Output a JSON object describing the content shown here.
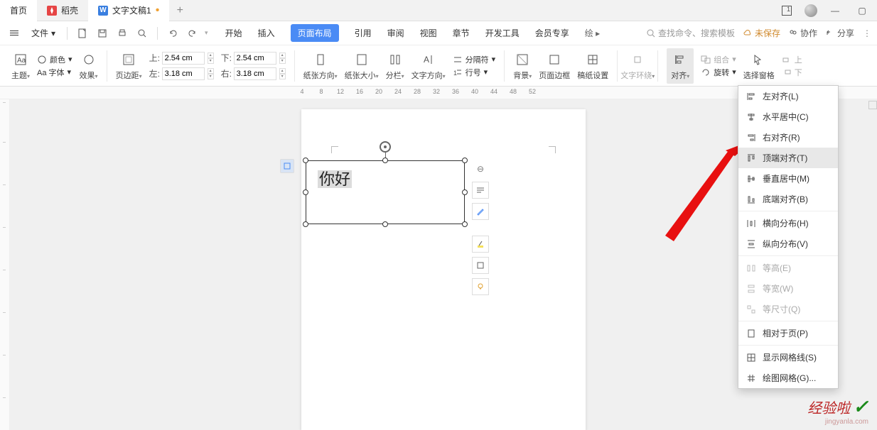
{
  "titlebar": {
    "home": "首页",
    "shell_name": "稻壳",
    "doc_name": "文字文稿1",
    "newtab": "+"
  },
  "menu": {
    "file": "文件",
    "ribbon_tabs": [
      "开始",
      "插入",
      "页面布局",
      "引用",
      "审阅",
      "视图",
      "章节",
      "开发工具",
      "会员专享"
    ],
    "drawing": "绘",
    "search_placeholder": "查找命令、搜索模板",
    "unsaved": "未保存",
    "coop": "协作",
    "share": "分享"
  },
  "ribbon": {
    "theme": "主题",
    "color": "颜色",
    "font": "Aa 字体",
    "effect": "效果",
    "margin": "页边距",
    "top": "上:",
    "bot": "下:",
    "left_m": "左:",
    "right_m": "右:",
    "m_vert": "2.54 cm",
    "m_horz": "3.18 cm",
    "orient": "纸张方向",
    "size": "纸张大小",
    "columns": "分栏",
    "textdir": "文字方向",
    "break": "分隔符",
    "lineno": "行号",
    "bg": "背景",
    "border": "页面边框",
    "grid": "稿纸设置",
    "wrap": "文字环绕",
    "align": "对齐",
    "group": "组合",
    "rotate": "旋转",
    "selpane": "选择窗格",
    "moveup": "上",
    "movedown": "下"
  },
  "ruler": [
    "4",
    "8",
    "12",
    "16",
    "20",
    "24",
    "28",
    "32",
    "36",
    "40",
    "44",
    "48",
    "52"
  ],
  "textbox_text": "你好",
  "align_menu": {
    "items": [
      {
        "icon": "al",
        "label": "左对齐(L)"
      },
      {
        "icon": "ac",
        "label": "水平居中(C)"
      },
      {
        "icon": "ar",
        "label": "右对齐(R)"
      },
      {
        "icon": "at",
        "label": "顶端对齐(T)",
        "hl": true
      },
      {
        "icon": "am",
        "label": "垂直居中(M)"
      },
      {
        "icon": "ab",
        "label": "底端对齐(B)"
      }
    ],
    "dist": [
      {
        "icon": "dh",
        "label": "横向分布(H)"
      },
      {
        "icon": "dv",
        "label": "纵向分布(V)"
      }
    ],
    "equal": [
      {
        "icon": "eh",
        "label": "等高(E)"
      },
      {
        "icon": "ew",
        "label": "等宽(W)"
      },
      {
        "icon": "es",
        "label": "等尺寸(Q)"
      }
    ],
    "rel": {
      "icon": "rp",
      "label": "相对于页(P)"
    },
    "grid_items": [
      {
        "icon": "gs",
        "label": "显示网格线(S)"
      },
      {
        "icon": "gd",
        "label": "绘图网格(G)..."
      }
    ]
  },
  "watermark": {
    "brand": "经验啦",
    "url": "jingyanla.com"
  }
}
